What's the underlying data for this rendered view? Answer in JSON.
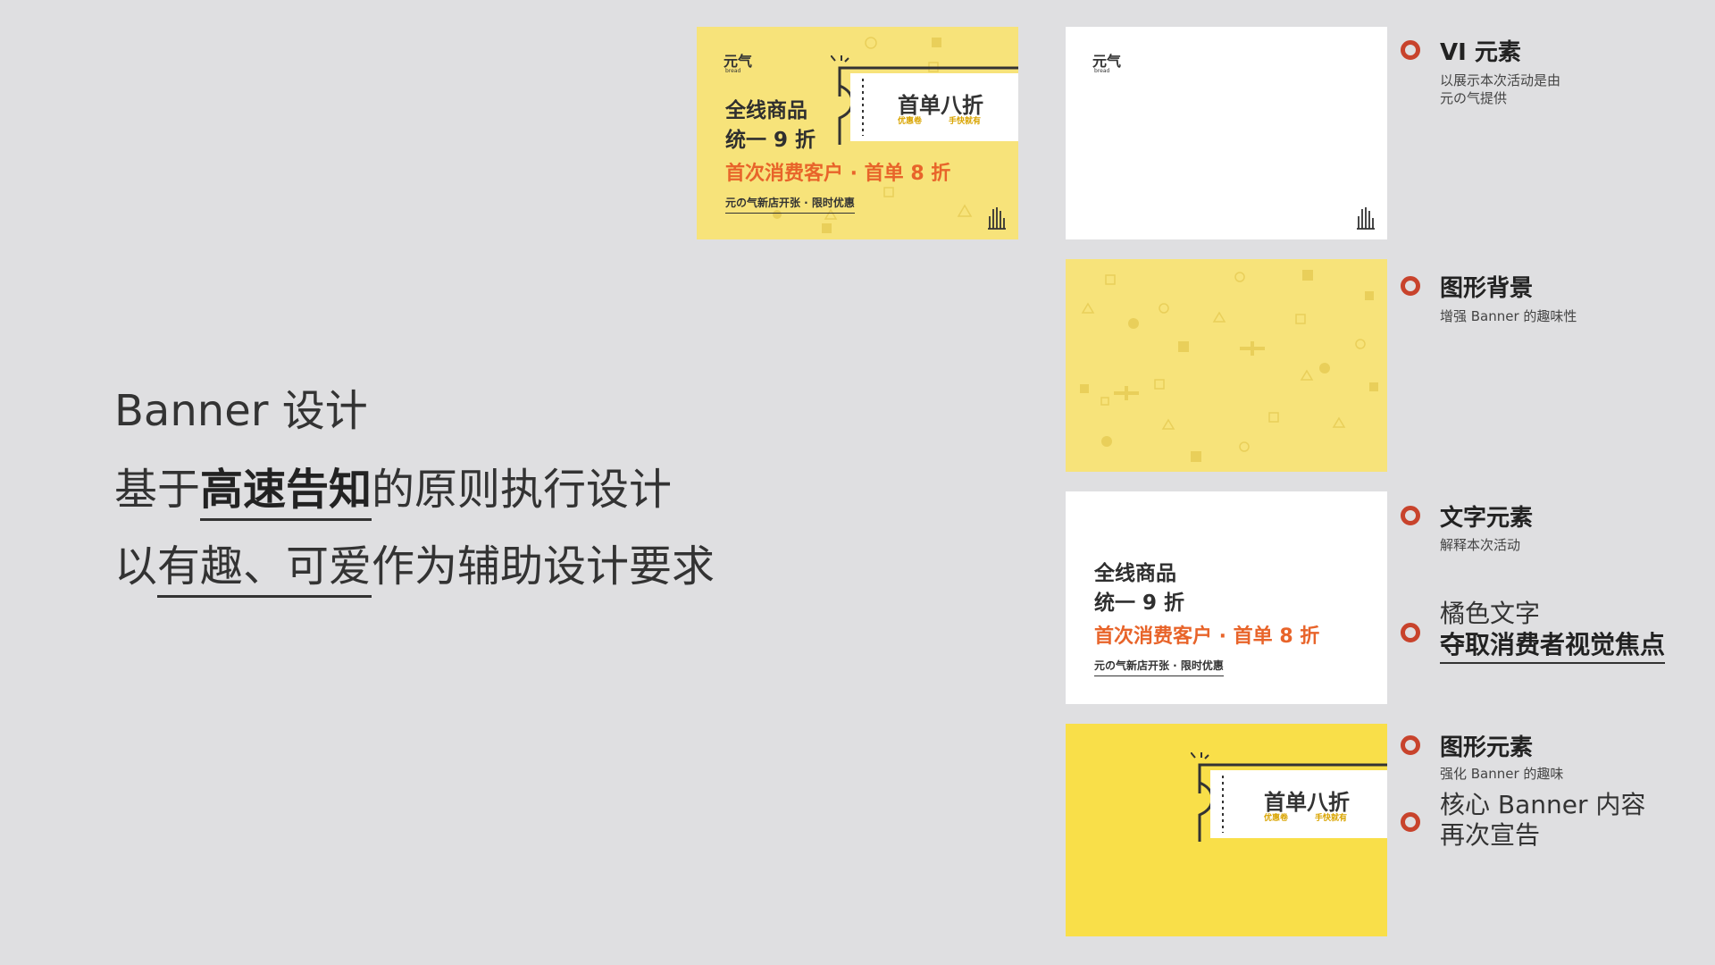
{
  "left": {
    "line1": "Banner 设计",
    "line2_pre": "基于",
    "line2_kw": "高速告知",
    "line2_post": "的原则执行设计",
    "line3_pre": "以",
    "line3_ul": "有趣、可爱",
    "line3_post": "作为辅助设计要求"
  },
  "banner": {
    "logo": "元气",
    "logo_sub": "bread",
    "title1": "全线商品",
    "title2": "统一 9 折",
    "orange": "首次消费客户 · 首单 8 折",
    "small": "元の气新店开张 · 限时优惠",
    "ticket_main": "首单八折",
    "ticket_sub1": "优惠卷",
    "ticket_sub2": "手快就有"
  },
  "annotations": {
    "vi_title": "VI 元素",
    "vi_desc1": "以展示本次活动是由",
    "vi_desc2": "元の气提供",
    "bg_title": "图形背景",
    "bg_desc": "增强 Banner 的趣味性",
    "text_title": "文字元素",
    "text_desc": "解释本次活动",
    "orange_line1": "橘色文字",
    "orange_line2": "夺取消费者视觉焦点",
    "gfx_title": "图形元素",
    "gfx_desc": "强化 Banner 的趣味",
    "core_line1": "核心 Banner 内容",
    "core_line2": "再次宣告"
  },
  "colors": {
    "background": "#dfdfe1",
    "yellow_pattern": "#f7e37a",
    "yellow_solid": "#f9df49",
    "orange_text": "#e8642a",
    "ring_red": "#c8432c"
  }
}
